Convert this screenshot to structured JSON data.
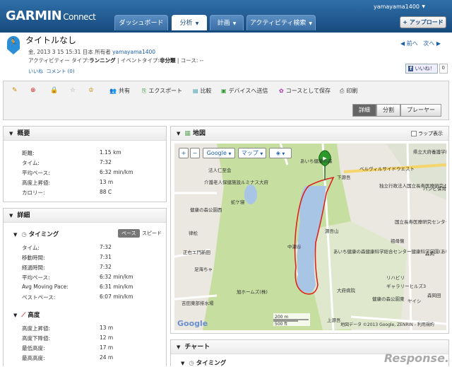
{
  "header": {
    "brand": "GARMIN",
    "brand_sub": "Connect",
    "username": "yamayama1400",
    "upload_label": "+ アップロード",
    "tabs": [
      {
        "label": "ダッシュボード"
      },
      {
        "label": "分析"
      },
      {
        "label": "計画"
      },
      {
        "label": "アクティビティ検索"
      }
    ]
  },
  "activity": {
    "title": "タイトルなし",
    "date_owner": "金, 2013 3 15 15:31 日本 所有者",
    "owner": "yamayama1400",
    "type_prefix": "アクティビティー タイプ:",
    "type": "ランニング",
    "event_prefix": " | イベントタイプ:",
    "event": "非分類",
    "course": " | コース: --",
    "like": "いいね",
    "comment": "コメント (0)",
    "prev": "◀ 前へ",
    "next": "次へ ▶",
    "fb_like": "いいね！",
    "fb_count": "0"
  },
  "toolbar": {
    "share": "共有",
    "export": "エクスポート",
    "compare": "比較",
    "send": "デバイスへ送信",
    "save_course": "コースとして保存",
    "print": "印刷",
    "views": [
      "詳細",
      "分割",
      "プレーヤー"
    ]
  },
  "overview": {
    "title": "概要",
    "rows": [
      {
        "k": "距離:",
        "v": "1.15 km"
      },
      {
        "k": "タイム:",
        "v": "7:32"
      },
      {
        "k": "平均ペース:",
        "v": "6:32 min/km"
      },
      {
        "k": "高度上昇値:",
        "v": "13 m"
      },
      {
        "k": "カロリー:",
        "v": "88 C"
      }
    ]
  },
  "details": {
    "title": "詳細",
    "timing": "タイミング",
    "pace_btn": "ペース",
    "speed_btn": "スピード",
    "timing_rows": [
      {
        "k": "タイム:",
        "v": "7:32"
      },
      {
        "k": "移動時間:",
        "v": "7:31"
      },
      {
        "k": "経過時間:",
        "v": "7:32"
      },
      {
        "k": "平均ペース:",
        "v": "6:32 min/km"
      },
      {
        "k": "Avg Moving Pace:",
        "v": "6:31 min/km"
      },
      {
        "k": "ベストペース:",
        "v": "6:07 min/km"
      }
    ],
    "elevation": "高度",
    "elev_rows": [
      {
        "k": "高度上昇値:",
        "v": "13 m"
      },
      {
        "k": "高度下降値:",
        "v": "12 m"
      },
      {
        "k": "最低高度:",
        "v": "17 m"
      },
      {
        "k": "最高高度:",
        "v": "24 m"
      }
    ]
  },
  "mappanel": {
    "title": "地図",
    "lap": "ラップ表示",
    "google": "Google",
    "map": "マップ",
    "labels": [
      "あいち健康の森",
      "法人仁至会",
      "介護老人保健施設ルミナス大府",
      "健康の森公園西",
      "蛇ケ寝",
      "律松",
      "正右エ門新田",
      "足海ちゃ",
      "吉田東部排水場",
      "旭ホームズ(株)",
      "中瀬谷",
      "源吾山",
      "下源吾",
      "あいち健康の森健康科学総合センター健康科学学園(あいち健康プラザ)",
      "大府病院",
      "健康の森公園東",
      "ヤイシ",
      "国立長寿医療研究センター",
      "祖母懐",
      "森岡",
      "森岡田",
      "リハビリ",
      "ギャラリーヒルズ3",
      "上源吾",
      "県立大府養護学校",
      "独立行政法人国立長寿医療研究センター",
      "バンビ保育所",
      "ベルヴィルサイドウエスト"
    ],
    "scale_m": "200 m",
    "scale_ft": "500 ft",
    "copyright": "地図データ ©2013 Google, ZENRIN - 利用規約",
    "google_logo": "Google"
  },
  "chart": {
    "title": "チャート",
    "timing": "タイミング"
  },
  "watermark": "Response."
}
